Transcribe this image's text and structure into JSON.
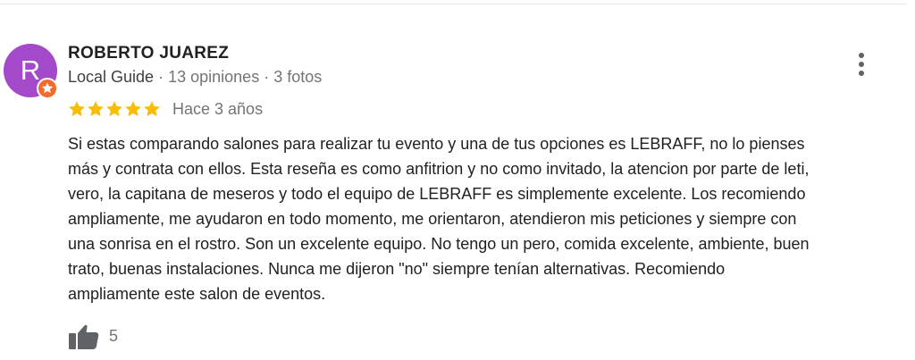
{
  "review": {
    "author": {
      "avatar_letter": "R",
      "avatar_color": "#a349c9",
      "badge_icon": "local-guide-star-icon",
      "badge_color": "#f26b2c",
      "name": "ROBERTO JUAREZ",
      "guide_label": "Local Guide",
      "reviews_count": "13 opiniones",
      "photos_count": "3 fotos",
      "separator": "·"
    },
    "menu_icon": "more-vertical-icon",
    "rating": 5,
    "star_color": "#fbbc04",
    "date": "Hace 3 años",
    "text": "Si estas comparando salones para realizar tu evento y una de tus opciones es LEBRAFF, no lo pienses\nmás y contrata con ellos. Esta reseña es como anfitrion y no como invitado, la atencion por parte de leti,\nvero, la capitana de meseros y todo el equipo de LEBRAFF es simplemente excelente. Los recomiendo\nampliamente, me ayudaron en todo momento, me orientaron, atendieron mis peticiones y siempre con\nuna sonrisa en el rostro. Son un excelente equipo. No tengo un pero, comida excelente, ambiente, buen\ntrato, buenas instalaciones. Nunca me dijeron \"no\" siempre tenían alternativas. Recomiendo\nampliamente este salon de eventos.",
    "like_icon": "thumbs-up-icon",
    "likes": "5"
  }
}
